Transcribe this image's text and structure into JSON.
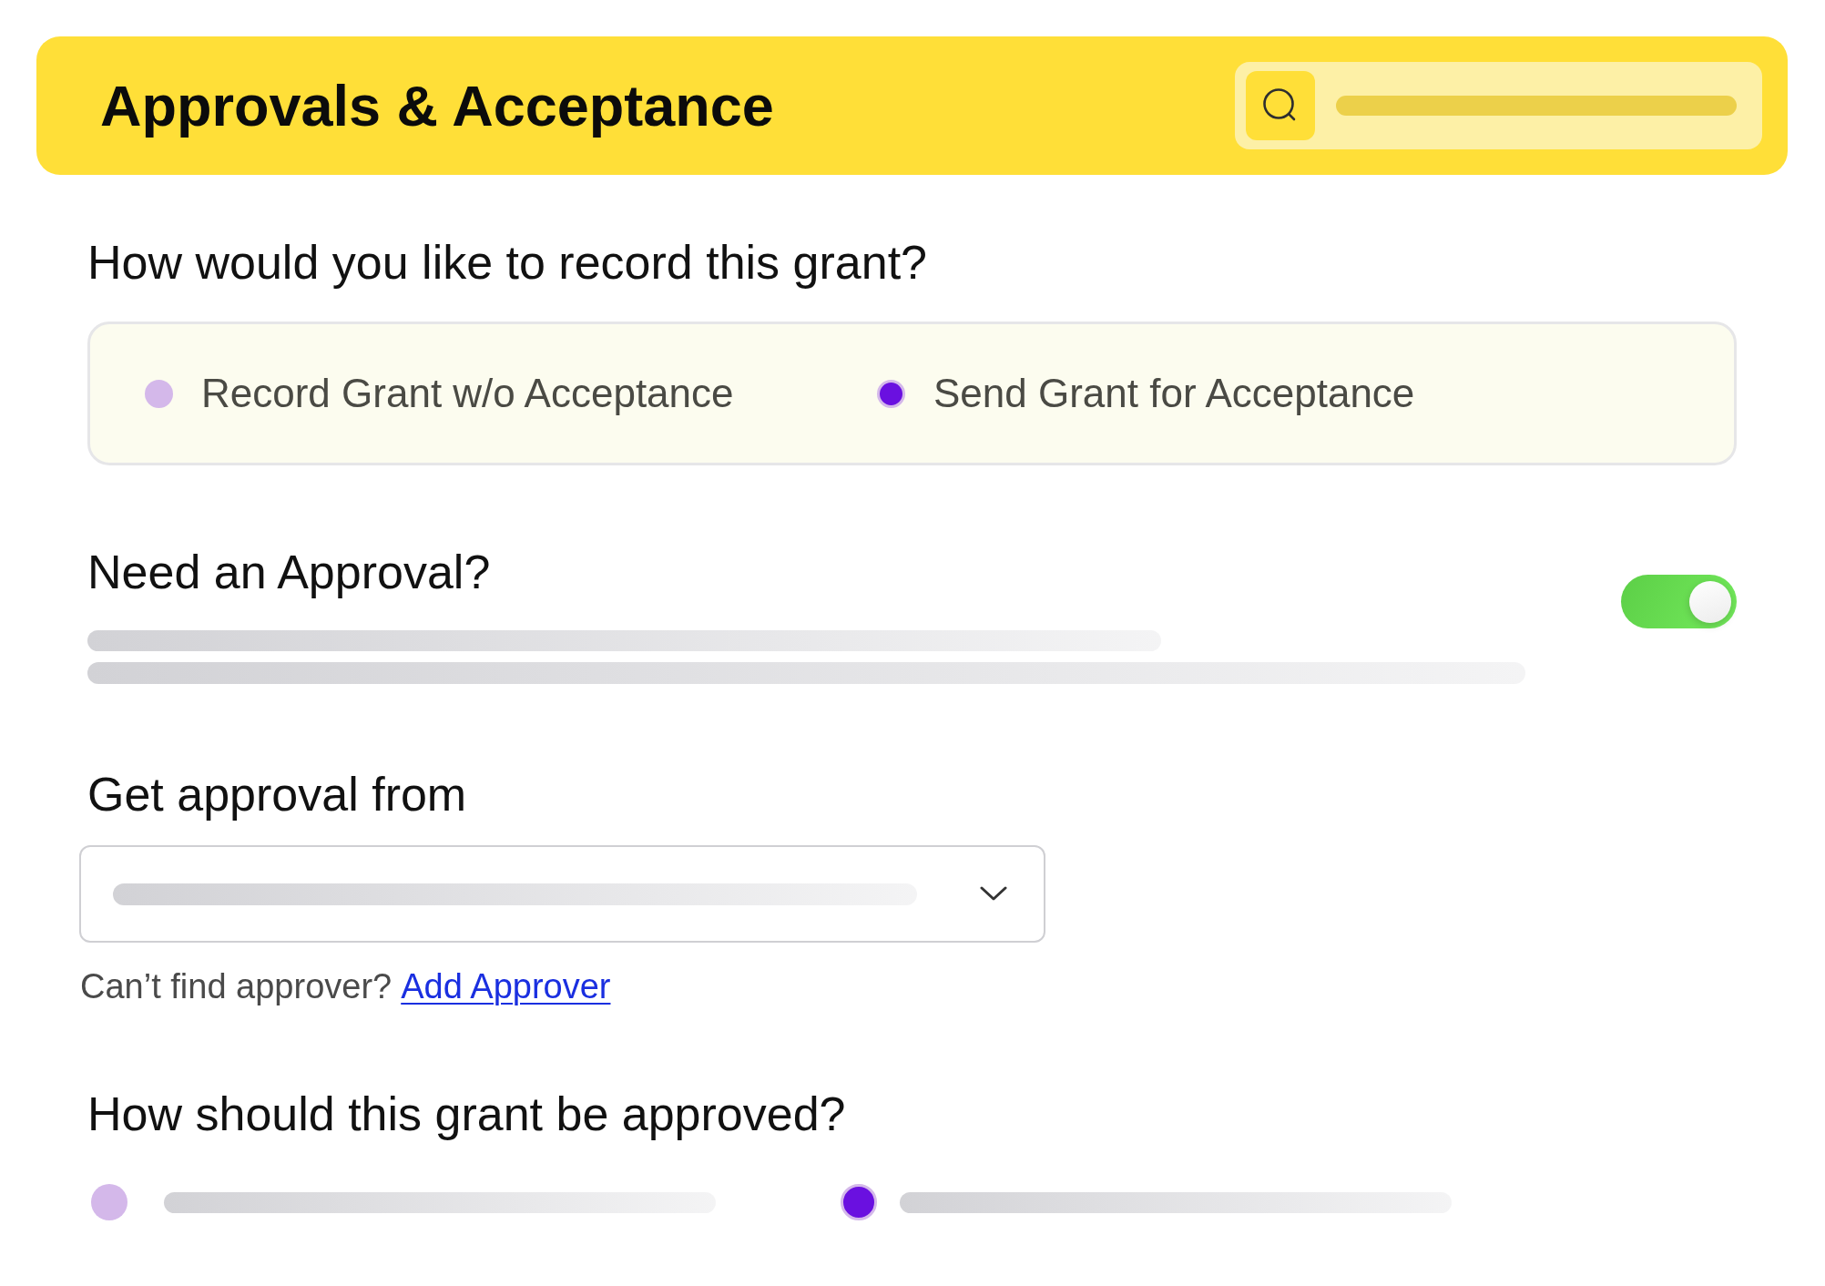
{
  "header": {
    "title": "Approvals & Acceptance"
  },
  "record_question": {
    "title": "How would you like to record this grant?",
    "options": [
      {
        "label": "Record Grant w/o Acceptance",
        "selected": false
      },
      {
        "label": "Send Grant for Acceptance",
        "selected": true
      }
    ]
  },
  "approval": {
    "title": "Need an Approval?",
    "on": true
  },
  "approver": {
    "title": "Get approval from",
    "hint": "Can’t find approver?",
    "link": "Add Approver"
  },
  "approval_method": {
    "title": "How should this grant be approved?",
    "options": [
      {
        "selected": false
      },
      {
        "selected": true
      }
    ]
  }
}
